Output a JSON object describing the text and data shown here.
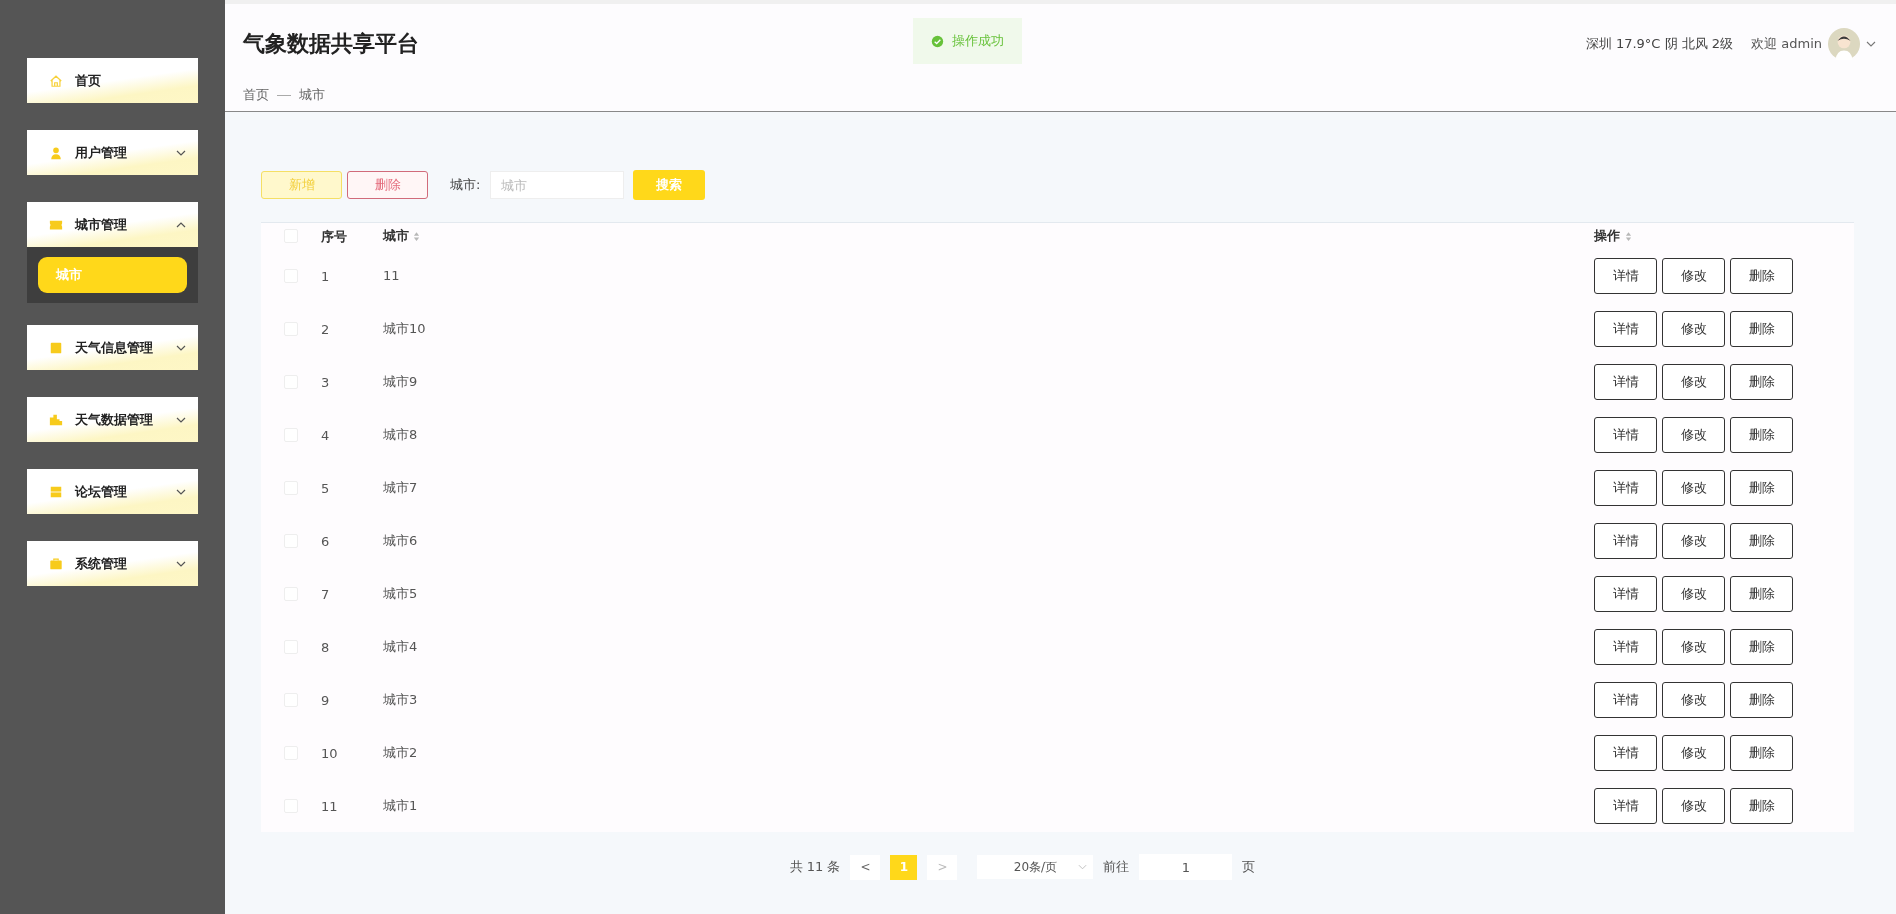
{
  "sidebar": {
    "items": [
      {
        "label": "首页",
        "kind": "link"
      },
      {
        "label": "用户管理",
        "kind": "group",
        "expanded": false
      },
      {
        "label": "城市管理",
        "kind": "group",
        "expanded": true,
        "children": [
          {
            "label": "城市",
            "selected": true
          }
        ]
      },
      {
        "label": "天气信息管理",
        "kind": "group",
        "expanded": false
      },
      {
        "label": "天气数据管理",
        "kind": "group",
        "expanded": false
      },
      {
        "label": "论坛管理",
        "kind": "group",
        "expanded": false
      },
      {
        "label": "系统管理",
        "kind": "group",
        "expanded": false
      }
    ]
  },
  "header": {
    "title": "气象数据共享平台",
    "toast": "操作成功",
    "weather": "深圳 17.9°C 阴 北风 2级",
    "welcome": "欢迎 admin"
  },
  "breadcrumb": [
    "首页",
    "城市"
  ],
  "toolbar": {
    "add": "新增",
    "delete": "删除",
    "filter_label": "城市:",
    "filter_placeholder": "城市",
    "search": "搜索"
  },
  "table": {
    "columns": [
      "序号",
      "城市",
      "操作"
    ],
    "all_checked": false,
    "rows": [
      {
        "index": "1",
        "city": "11",
        "checked": false,
        "actions": [
          "详情",
          "修改",
          "删除"
        ]
      },
      {
        "index": "2",
        "city": "城市10",
        "checked": false,
        "actions": [
          "详情",
          "修改",
          "删除"
        ]
      },
      {
        "index": "3",
        "city": "城市9",
        "checked": false,
        "actions": [
          "详情",
          "修改",
          "删除"
        ]
      },
      {
        "index": "4",
        "city": "城市8",
        "checked": false,
        "actions": [
          "详情",
          "修改",
          "删除"
        ]
      },
      {
        "index": "5",
        "city": "城市7",
        "checked": false,
        "actions": [
          "详情",
          "修改",
          "删除"
        ]
      },
      {
        "index": "6",
        "city": "城市6",
        "checked": false,
        "actions": [
          "详情",
          "修改",
          "删除"
        ]
      },
      {
        "index": "7",
        "city": "城市5",
        "checked": false,
        "actions": [
          "详情",
          "修改",
          "删除"
        ]
      },
      {
        "index": "8",
        "city": "城市4",
        "checked": false,
        "actions": [
          "详情",
          "修改",
          "删除"
        ]
      },
      {
        "index": "9",
        "city": "城市3",
        "checked": false,
        "actions": [
          "详情",
          "修改",
          "删除"
        ]
      },
      {
        "index": "10",
        "city": "城市2",
        "checked": false,
        "actions": [
          "详情",
          "修改",
          "删除"
        ]
      },
      {
        "index": "11",
        "city": "城市1",
        "checked": false,
        "actions": [
          "详情",
          "修改",
          "删除"
        ]
      }
    ]
  },
  "pagination": {
    "total": "共 11 条",
    "prev": "<",
    "pages": [
      {
        "label": "1",
        "selected": true
      }
    ],
    "next": ">",
    "page_size": "20条/页",
    "goto_label": "前往",
    "goto_value": "1",
    "goto_suffix": "页"
  }
}
